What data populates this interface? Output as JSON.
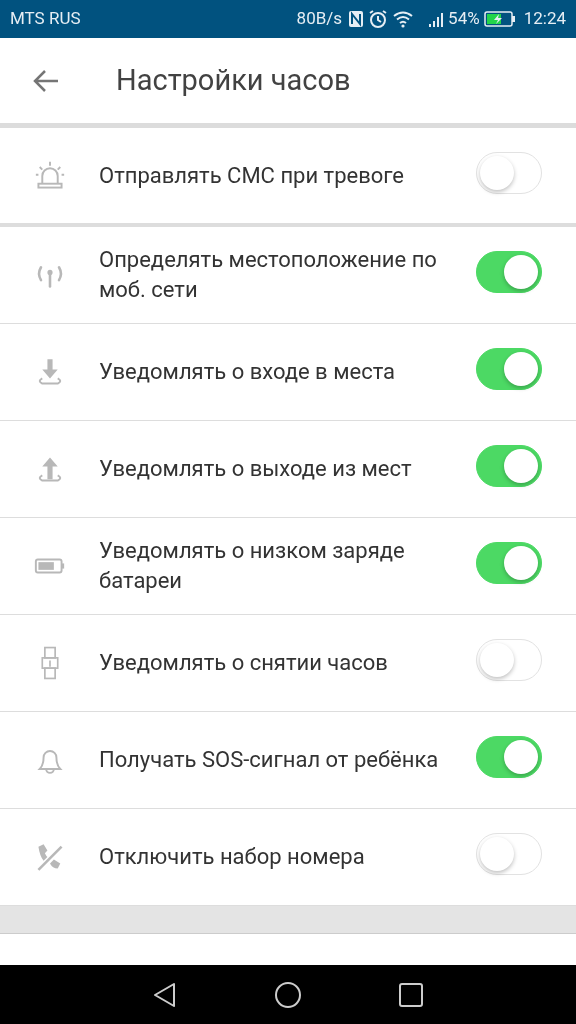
{
  "status_bar": {
    "carrier": "MTS RUS",
    "speed": "80B/s",
    "battery_percent": "54%",
    "time": "12:24"
  },
  "header": {
    "title": "Настройки часов"
  },
  "settings": [
    {
      "label": "Отправлять СМС при тревоге",
      "on": false
    },
    {
      "label": "Определять местоположение по моб. сети",
      "on": true
    },
    {
      "label": "Уведомлять о входе в места",
      "on": true
    },
    {
      "label": "Уведомлять о выходе из мест",
      "on": true
    },
    {
      "label": "Уведомлять о низком заряде батареи",
      "on": true
    },
    {
      "label": "Уведомлять о снятии часов",
      "on": false
    },
    {
      "label": "Получать SOS-сигнал от ребёнка",
      "on": true
    },
    {
      "label": "Отключить набор номера",
      "on": false
    }
  ]
}
